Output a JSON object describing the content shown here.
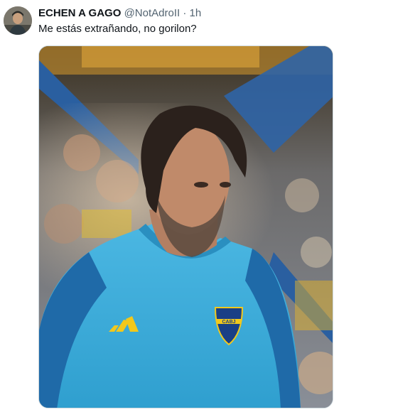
{
  "tweet": {
    "display_name": "ECHEN A GAGO",
    "handle": "@NotAdroII",
    "separator": "·",
    "time": "1h",
    "text": "Me estás extrañando, no gorilon?"
  },
  "media": {
    "crest_text": "CABJ",
    "icon": "photo-of-coach-in-light-blue-training-shirt"
  },
  "colors": {
    "shirt": "#34a9d8",
    "shirt_dark": "#1f6aa8",
    "accent_yellow": "#f2c81b",
    "stands_blue": "#2a5fa0"
  }
}
